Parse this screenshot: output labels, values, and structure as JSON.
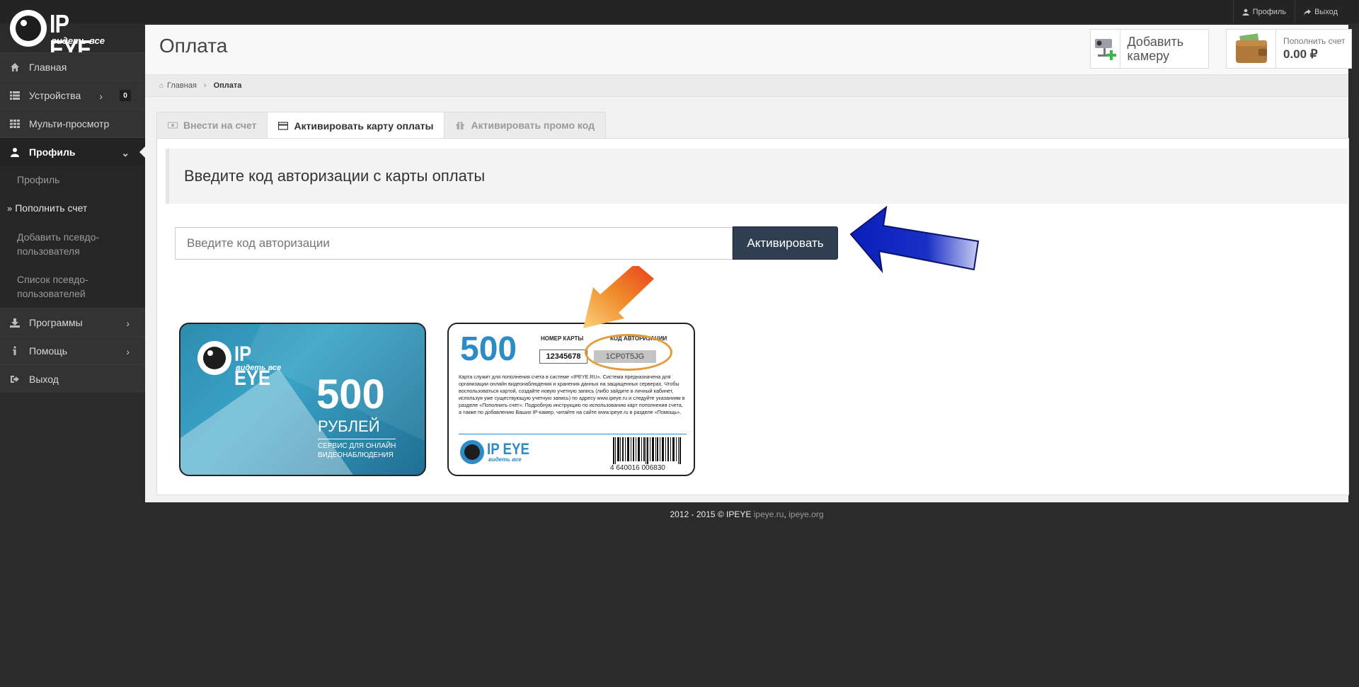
{
  "topbar": {
    "profile_label": "Профиль",
    "logout_label": "Выход"
  },
  "logo": {
    "name": "IP EYE",
    "tagline": "видеть все"
  },
  "sidebar": {
    "items": [
      {
        "label": "Главная",
        "icon": "home-icon"
      },
      {
        "label": "Устройства",
        "icon": "list-icon",
        "badge": "0"
      },
      {
        "label": "Мульти-просмотр",
        "icon": "grid-icon"
      },
      {
        "label": "Профиль",
        "icon": "user-icon"
      },
      {
        "label": "Программы",
        "icon": "download-icon"
      },
      {
        "label": "Помощь",
        "icon": "info-icon"
      },
      {
        "label": "Выход",
        "icon": "sign-out-icon"
      }
    ],
    "profile_sub": [
      {
        "label": "Профиль"
      },
      {
        "label": "Пополнить счет"
      },
      {
        "label": "Добавить псевдо-пользователя"
      },
      {
        "label": "Список псевдо-пользователей"
      }
    ]
  },
  "header": {
    "title": "Оплата",
    "add_camera_label": "Добавить камеру",
    "wallet_label": "Пополнить счет",
    "wallet_balance": "0.00 ₽"
  },
  "breadcrumb": {
    "home": "Главная",
    "current": "Оплата"
  },
  "tabs": [
    {
      "label": "Внести на счет",
      "icon": "money-icon"
    },
    {
      "label": "Активировать карту оплаты",
      "icon": "credit-card-icon"
    },
    {
      "label": "Активировать промо код",
      "icon": "gift-icon"
    }
  ],
  "activate": {
    "heading": "Введите код авторизации с карты оплаты",
    "input_placeholder": "Введите код авторизации",
    "button_label": "Активировать"
  },
  "card_front": {
    "brand": "IP EYE",
    "tagline": "видеть все",
    "amount": "500",
    "currency": "РУБЛЕЙ",
    "desc": "СЕРВИС ДЛЯ ОНЛАЙН ВИДЕОНАБЛЮДЕНИЯ"
  },
  "card_back": {
    "amount": "500",
    "card_number_label": "НОМЕР КАРТЫ",
    "auth_code_label": "КОД АВТОРИЗАЦИИ",
    "card_number": "12345678",
    "auth_code": "1CP0T5JG",
    "text": "Карта служит для пополнения счета в системе «IPEYE.RU». Система предназначена для организации онлайн видеонаблюдения и хранения данных на защищенных серверах. Чтобы воспользоваться картой, создайте новую учетную запись (либо зайдите в личный кабинет, используя уже существующую учетную запись) по адресу www.ipeye.ru и следуйте указаниям в разделе «Пополнить счет». Подробную инструкцию по использованию карт пополнения счета, а также по добавлению Ваших IP-камер, читайте на сайте www.ipeye.ru в разделе «Помощь».",
    "brand": "IP EYE",
    "tagline": "видеть все",
    "barcode_number": "4 640016 006830"
  },
  "footer": {
    "copyright": "2012 - 2015 © IPEYE",
    "link1": "ipeye.ru",
    "sep": ",",
    "link2": "ipeye.org"
  }
}
